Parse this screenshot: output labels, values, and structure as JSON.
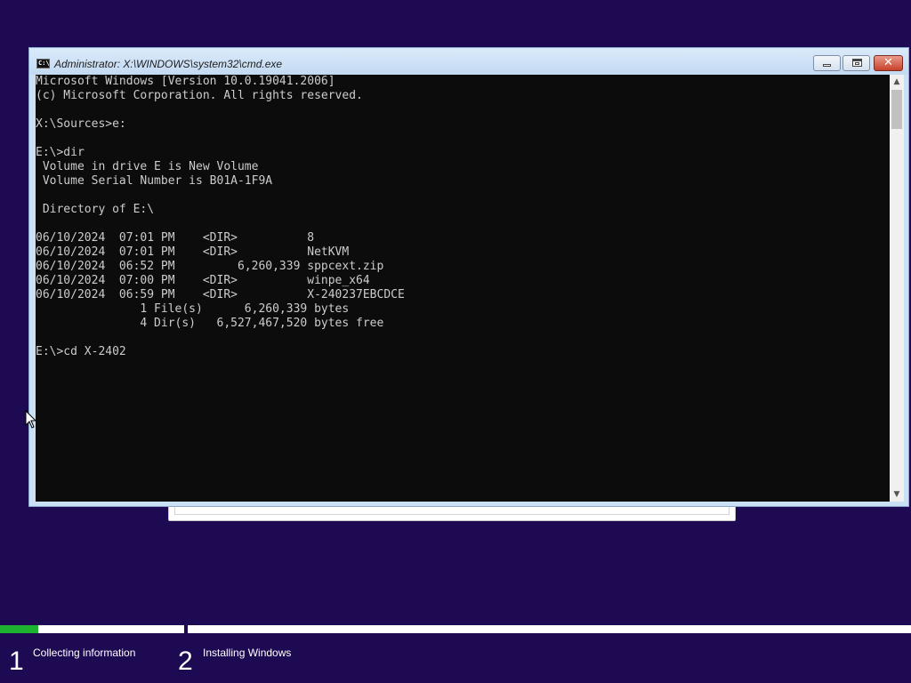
{
  "window": {
    "title": "Administrator: X:\\WINDOWS\\system32\\cmd.exe",
    "icon": "console-icon",
    "buttons": [
      "minimize",
      "maximize",
      "close"
    ]
  },
  "console": {
    "lines": [
      "Microsoft Windows [Version 10.0.19041.2006]",
      "(c) Microsoft Corporation. All rights reserved.",
      "",
      "X:\\Sources>e:",
      "",
      "E:\\>dir",
      " Volume in drive E is New Volume",
      " Volume Serial Number is B01A-1F9A",
      "",
      " Directory of E:\\",
      "",
      "06/10/2024  07:01 PM    <DIR>          8",
      "06/10/2024  07:01 PM    <DIR>          NetKVM",
      "06/10/2024  06:52 PM         6,260,339 sppcext.zip",
      "06/10/2024  07:00 PM    <DIR>          winpe_x64",
      "06/10/2024  06:59 PM    <DIR>          X-240237EBCDCE",
      "               1 File(s)      6,260,339 bytes",
      "               4 Dir(s)   6,527,467,520 bytes free",
      "",
      "E:\\>cd X-2402"
    ],
    "background": "#0c0c0c",
    "foreground": "#cccccc"
  },
  "setup": {
    "steps": [
      {
        "number": "1",
        "label": "Collecting information",
        "progress": 0.21
      },
      {
        "number": "2",
        "label": "Installing Windows",
        "progress": 0
      }
    ],
    "progress_color": "#1db32f",
    "background": "#1e0a52"
  }
}
